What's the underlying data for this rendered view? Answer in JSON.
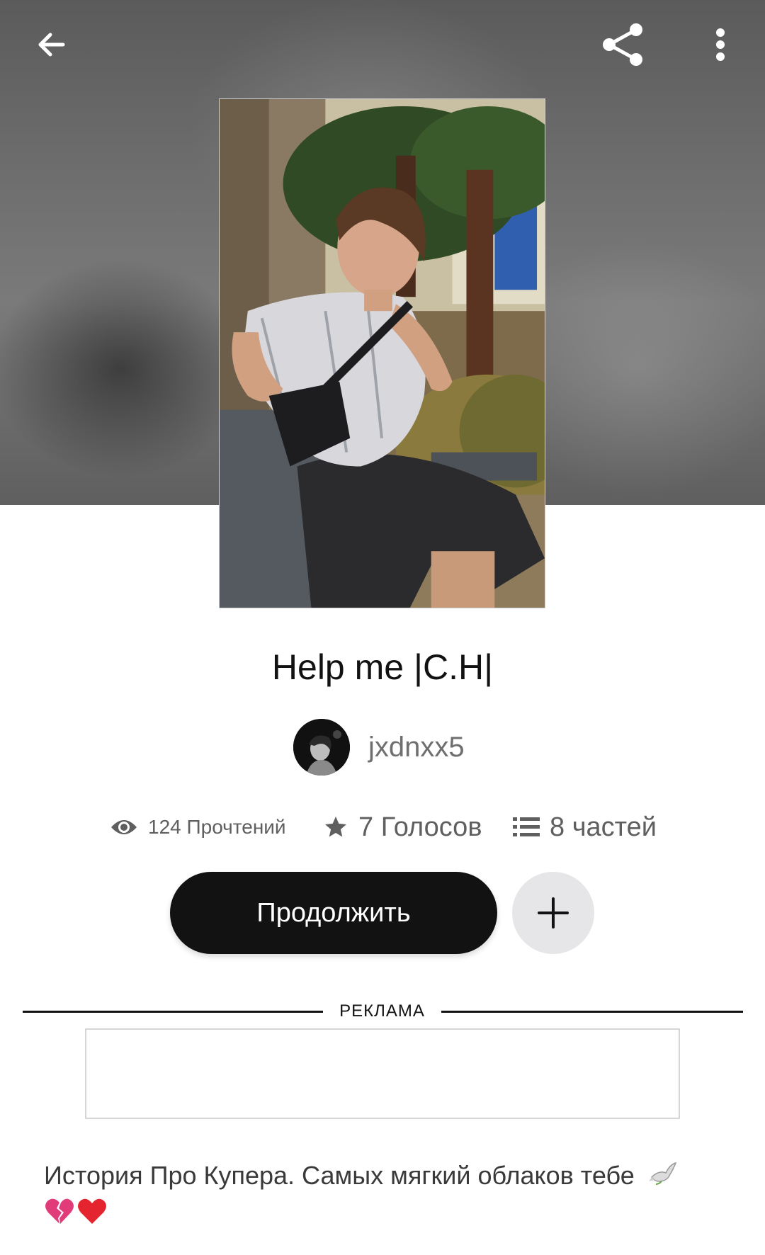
{
  "header": {
    "back_icon": "arrow-left-icon",
    "share_icon": "share-icon",
    "more_icon": "more-vertical-icon"
  },
  "story": {
    "title": "Help me |C.H|",
    "author": "jxdnxx5",
    "stats": {
      "reads": "124 Прочтений",
      "votes": "7 Голосов",
      "parts": "8 частей"
    },
    "continue_label": "Продолжить",
    "description": "История Про Купера. Самых мягкий облаков тебе"
  },
  "ad": {
    "label": "РЕКЛАМА"
  },
  "colors": {
    "primary": "#121212",
    "muted_text": "#6f6f6f",
    "add_button_bg": "#e6e6e8",
    "broken_heart": "#e23b7a",
    "heart": "#e4242e"
  }
}
